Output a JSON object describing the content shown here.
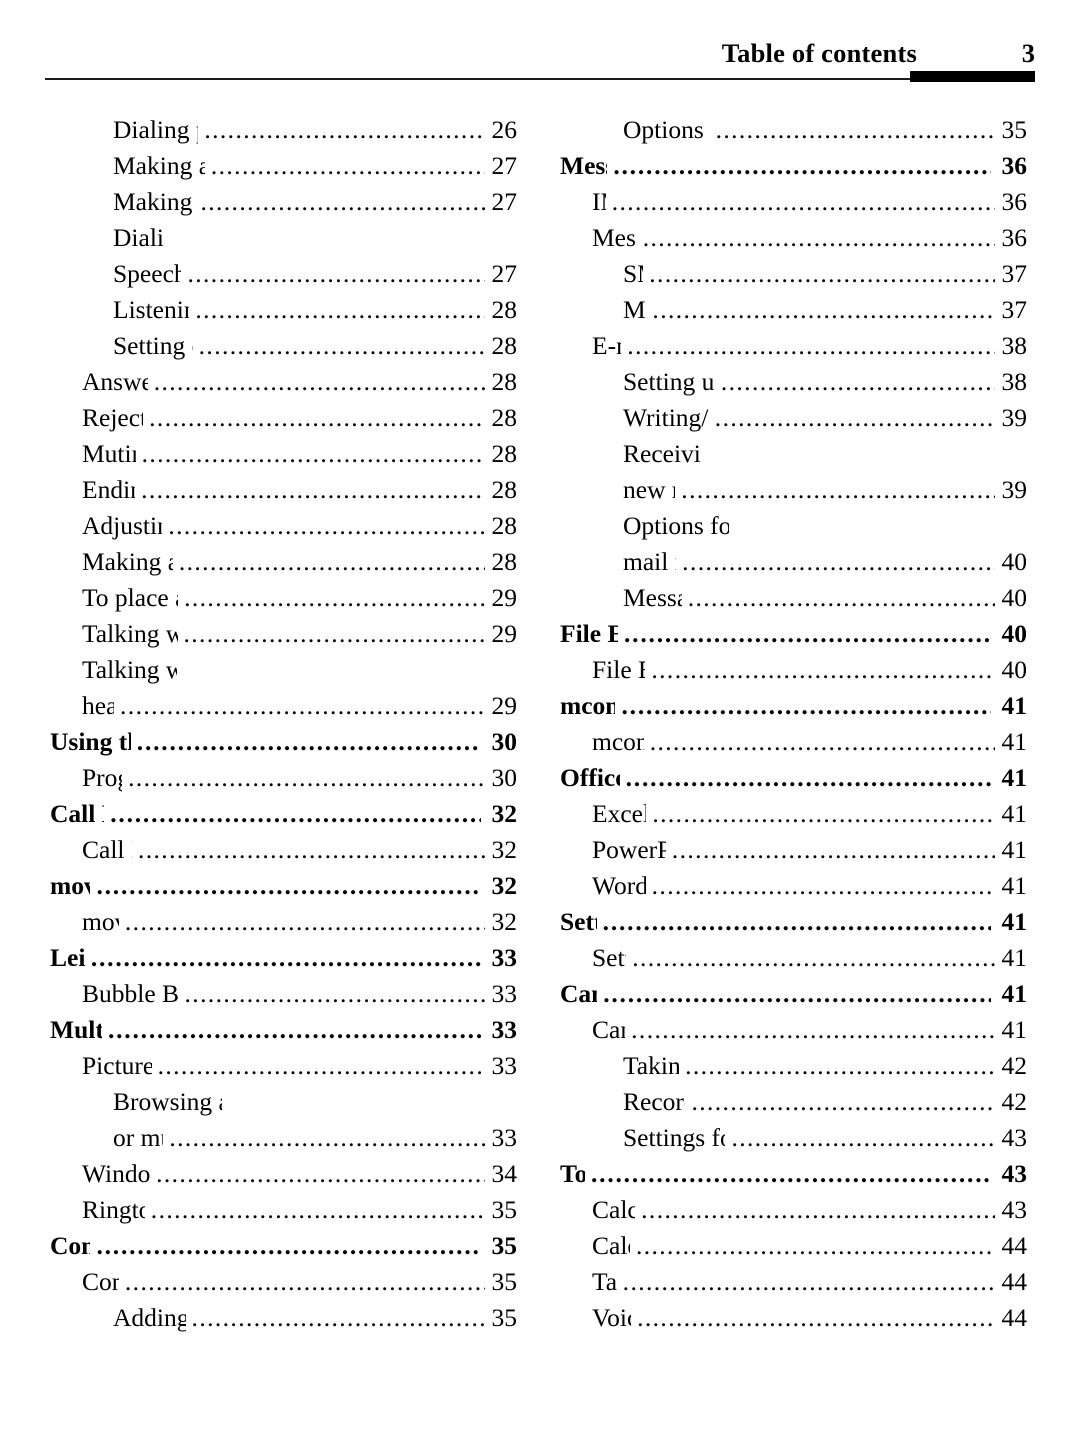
{
  "header": {
    "title": "Table of contents",
    "page_number": "3"
  },
  "leader_dots": "................................................................................................................",
  "columns": [
    {
      "name": "left",
      "entries": [
        {
          "level": 2,
          "label": "Dialing previous numbers",
          "page": "26",
          "wrapped": false
        },
        {
          "level": 2,
          "label": "Making a call from Contacts",
          "page": "27",
          "wrapped": false
        },
        {
          "level": 2,
          "label": "Making a speed dial call",
          "page": "27",
          "wrapped": false
        },
        {
          "level": 2,
          "label": "Dialing using",
          "page": "",
          "wrapped": true
        },
        {
          "level": 2,
          "label": "Speech commander",
          "page": "27",
          "wrapped": false
        },
        {
          "level": 2,
          "label": "Listening to voicemail",
          "page": "28",
          "wrapped": false
        },
        {
          "level": 2,
          "label": "Setting connection alert",
          "page": "28",
          "wrapped": false
        },
        {
          "level": 1,
          "label": "Answering a call",
          "page": "28",
          "wrapped": false
        },
        {
          "level": 1,
          "label": "Rejecting a call",
          "page": "28",
          "wrapped": false
        },
        {
          "level": 1,
          "label": "Muting a call",
          "page": "28",
          "wrapped": false
        },
        {
          "level": 1,
          "label": "Ending a call",
          "page": "28",
          "wrapped": false
        },
        {
          "level": 1,
          "label": "Adjusting the volume",
          "page": "28",
          "wrapped": false
        },
        {
          "level": 1,
          "label": "Making a conference call",
          "page": "28",
          "wrapped": false
        },
        {
          "level": 1,
          "label": "To place an emergency call",
          "page": "29",
          "wrapped": false
        },
        {
          "level": 1,
          "label": "Talking with speakerphone",
          "page": "29",
          "wrapped": false
        },
        {
          "level": 1,
          "label": "Talking with the handsfree",
          "page": "",
          "wrapped": true
        },
        {
          "level": 1,
          "label": "headset",
          "page": "29",
          "wrapped": false
        },
        {
          "level": 0,
          "label": "Using the programs",
          "page": "30",
          "wrapped": false
        },
        {
          "level": 1,
          "label": "Programs",
          "page": "30",
          "wrapped": false
        },
        {
          "level": 0,
          "label": "Call History",
          "page": "32",
          "wrapped": false
        },
        {
          "level": 1,
          "label": "Call History",
          "page": "32",
          "wrapped": false
        },
        {
          "level": 0,
          "label": "movistar",
          "page": "32",
          "wrapped": false
        },
        {
          "level": 1,
          "label": "movistar",
          "page": "32",
          "wrapped": false
        },
        {
          "level": 0,
          "label": "Leisure",
          "page": "33",
          "wrapped": false
        },
        {
          "level": 1,
          "label": "Bubble Breaker & Solitaire",
          "page": "33",
          "wrapped": false
        },
        {
          "level": 0,
          "label": "Multimedia",
          "page": "33",
          "wrapped": false
        },
        {
          "level": 1,
          "label": "Pictures & Videos",
          "page": "33",
          "wrapped": false
        },
        {
          "level": 2,
          "label": "Browsing and opening image, video",
          "page": "",
          "wrapped": true
        },
        {
          "level": 2,
          "label": "or music files",
          "page": "33",
          "wrapped": false
        },
        {
          "level": 1,
          "label": "Windows Media®",
          "page": "34",
          "wrapped": false,
          "has_superscript_reg": true,
          "base_label": "Windows Media"
        },
        {
          "level": 1,
          "label": "Ringtone Editor",
          "page": "35",
          "wrapped": false
        },
        {
          "level": 0,
          "label": "Contacts",
          "page": "35",
          "wrapped": false
        },
        {
          "level": 1,
          "label": "Contacts",
          "page": "35",
          "wrapped": false
        },
        {
          "level": 2,
          "label": "Adding new contacts",
          "page": "35",
          "wrapped": false
        }
      ]
    },
    {
      "name": "right",
      "entries": [
        {
          "level": 2,
          "label": "Options menu for contacts",
          "page": "35",
          "wrapped": false
        },
        {
          "level": 0,
          "label": "Messaging",
          "page": "36",
          "wrapped": false
        },
        {
          "level": 1,
          "label": "IM",
          "page": "36",
          "wrapped": false
        },
        {
          "level": 1,
          "label": "Messaging",
          "page": "36",
          "wrapped": false
        },
        {
          "level": 2,
          "label": "SMS",
          "page": "37",
          "wrapped": false
        },
        {
          "level": 2,
          "label": "MMS",
          "page": "37",
          "wrapped": false
        },
        {
          "level": 1,
          "label": "E-mail",
          "page": "38",
          "wrapped": false
        },
        {
          "level": 2,
          "label": "Setting up an e-mail account",
          "page": "38",
          "wrapped": false
        },
        {
          "level": 2,
          "label": "Writing/sending an e-mail",
          "page": "39",
          "wrapped": false
        },
        {
          "level": 2,
          "label": "Receiving and viewing",
          "page": "",
          "wrapped": true
        },
        {
          "level": 2,
          "label": "new messages",
          "page": "39",
          "wrapped": false
        },
        {
          "level": 2,
          "label": "Options for viewing SMS/MMS/e-",
          "page": "",
          "wrapped": true
        },
        {
          "level": 2,
          "label": "mail messages",
          "page": "40",
          "wrapped": false
        },
        {
          "level": 2,
          "label": "Message folders",
          "page": "40",
          "wrapped": false
        },
        {
          "level": 0,
          "label": "File Explorer",
          "page": "40",
          "wrapped": false
        },
        {
          "level": 1,
          "label": "File Explorer",
          "page": "40",
          "wrapped": false
        },
        {
          "level": 0,
          "label": "mcontenidos",
          "page": "41",
          "wrapped": false
        },
        {
          "level": 1,
          "label": "mcontenidos",
          "page": "41",
          "wrapped": false
        },
        {
          "level": 0,
          "label": "Office Mobile",
          "page": "41",
          "wrapped": false
        },
        {
          "level": 1,
          "label": "Excel Mobile",
          "page": "41",
          "wrapped": false
        },
        {
          "level": 1,
          "label": "PowerPoint Mobile",
          "page": "41",
          "wrapped": false
        },
        {
          "level": 1,
          "label": "Word Mobile",
          "page": "41",
          "wrapped": false
        },
        {
          "level": 0,
          "label": "Settings",
          "page": "41",
          "wrapped": false
        },
        {
          "level": 1,
          "label": "Settings",
          "page": "41",
          "wrapped": false
        },
        {
          "level": 0,
          "label": "Camera",
          "page": "41",
          "wrapped": false
        },
        {
          "level": 1,
          "label": "Camera",
          "page": "41",
          "wrapped": false
        },
        {
          "level": 2,
          "label": "Taking pictures",
          "page": "42",
          "wrapped": false
        },
        {
          "level": 2,
          "label": "Recording videos",
          "page": "42",
          "wrapped": false
        },
        {
          "level": 2,
          "label": "Settings for the image/video files",
          "page": "43",
          "wrapped": false
        },
        {
          "level": 0,
          "label": "Tools",
          "page": "43",
          "wrapped": false
        },
        {
          "level": 1,
          "label": "Calculator",
          "page": "43",
          "wrapped": false
        },
        {
          "level": 1,
          "label": "Calendar",
          "page": "44",
          "wrapped": false
        },
        {
          "level": 1,
          "label": "Tasks",
          "page": "44",
          "wrapped": false
        },
        {
          "level": 1,
          "label": "Voice tag",
          "page": "44",
          "wrapped": false
        }
      ]
    }
  ]
}
